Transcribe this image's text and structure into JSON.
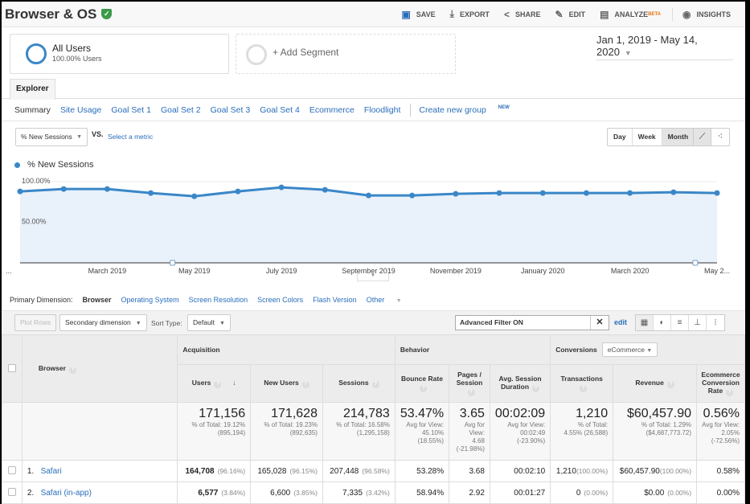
{
  "header": {
    "title": "Browser & OS",
    "actions": [
      {
        "label": "SAVE",
        "icon": "save-icon"
      },
      {
        "label": "EXPORT",
        "icon": "export-icon"
      },
      {
        "label": "SHARE",
        "icon": "share-icon"
      },
      {
        "label": "EDIT",
        "icon": "pencil-icon"
      },
      {
        "label": "ANALYZE",
        "icon": "analyze-icon",
        "badge": "BETA"
      },
      {
        "label": "INSIGHTS",
        "icon": "insights-icon"
      }
    ]
  },
  "segments": {
    "active": {
      "name": "All Users",
      "sub": "100.00% Users"
    },
    "add_label": "+ Add Segment"
  },
  "date_range": "Jan 1, 2019 - May 14, 2020",
  "tabs": {
    "explorer": "Explorer"
  },
  "subtabs": {
    "items": [
      "Summary",
      "Site Usage",
      "Goal Set 1",
      "Goal Set 2",
      "Goal Set 3",
      "Goal Set 4",
      "Ecommerce",
      "Floodlight"
    ],
    "create": "Create new group",
    "create_badge": "NEW"
  },
  "chart_controls": {
    "metric": "% New Sessions",
    "vs": "VS.",
    "select_metric": "Select a metric",
    "periods": [
      "Day",
      "Week",
      "Month"
    ],
    "active_period": "Month"
  },
  "chart_data": {
    "type": "area",
    "legend": "% New Sessions",
    "ylabels": [
      "100.00%",
      "50.00%"
    ],
    "ylim": [
      0,
      100
    ],
    "x": [
      "Jan 2019",
      "Feb 2019",
      "Mar 2019",
      "Apr 2019",
      "May 2019",
      "Jun 2019",
      "Jul 2019",
      "Aug 2019",
      "Sep 2019",
      "Oct 2019",
      "Nov 2019",
      "Dec 2019",
      "Jan 2020",
      "Feb 2020",
      "Mar 2020",
      "Apr 2020",
      "May 2020"
    ],
    "values": [
      88,
      91,
      91,
      86,
      82,
      88,
      93,
      90,
      83,
      83,
      85,
      86,
      86,
      86,
      86,
      87,
      86
    ],
    "xticks": [
      {
        "label": "...",
        "index": 0
      },
      {
        "label": "March 2019",
        "index": 2
      },
      {
        "label": "May 2019",
        "index": 4
      },
      {
        "label": "July 2019",
        "index": 6
      },
      {
        "label": "September 2019",
        "index": 8
      },
      {
        "label": "November 2019",
        "index": 10
      },
      {
        "label": "January 2020",
        "index": 12
      },
      {
        "label": "March 2020",
        "index": 14
      },
      {
        "label": "May 2...",
        "index": 16
      }
    ],
    "annotation_indices": [
      3,
      15
    ]
  },
  "dimensions": {
    "label": "Primary Dimension:",
    "active": "Browser",
    "others": [
      "Operating System",
      "Screen Resolution",
      "Screen Colors",
      "Flash Version"
    ],
    "other": "Other"
  },
  "toolbar": {
    "plot_rows": "Plot Rows",
    "secondary": "Secondary dimension",
    "sort_label": "Sort Type:",
    "sort_value": "Default",
    "filter_value": "Advanced Filter ON",
    "edit": "edit"
  },
  "table": {
    "dim_header": "Browser",
    "groups": {
      "acq": "Acquisition",
      "beh": "Behavior",
      "conv": "Conversions",
      "conv_select": "eCommerce"
    },
    "columns": [
      "Users",
      "New Users",
      "Sessions",
      "Bounce Rate",
      "Pages / Session",
      "Avg. Session Duration",
      "Transactions",
      "Revenue",
      "Ecommerce Conversion Rate"
    ],
    "totals": [
      {
        "value": "171,156",
        "sub1": "% of Total: 19.12%",
        "sub2": "(895,194)"
      },
      {
        "value": "171,628",
        "sub1": "% of Total: 19.23%",
        "sub2": "(892,635)"
      },
      {
        "value": "214,783",
        "sub1": "% of Total: 16.58%",
        "sub2": "(1,295,158)"
      },
      {
        "value": "53.47%",
        "sub1": "Avg for View:",
        "sub2": "45.10% (18.55%)"
      },
      {
        "value": "3.65",
        "sub1": "Avg for View:",
        "sub2": "4.68 (-21.98%)"
      },
      {
        "value": "00:02:09",
        "sub1": "Avg for View:",
        "sub2": "00:02:49 (-23.90%)"
      },
      {
        "value": "1,210",
        "sub1": "% of Total:",
        "sub2": "4.55% (26,588)"
      },
      {
        "value": "$60,457.90",
        "sub1": "% of Total: 1.29%",
        "sub2": "($4,687,773.72)"
      },
      {
        "value": "0.56%",
        "sub1": "Avg for View: 2.05%",
        "sub2": "(-72.56%)"
      }
    ],
    "rows": [
      {
        "num": "1.",
        "name": "Safari",
        "users": "164,708",
        "users_pct": "(96.16%)",
        "new_users": "165,028",
        "new_users_pct": "(96.15%)",
        "sessions": "207,448",
        "sessions_pct": "(96.58%)",
        "bounce": "53.28%",
        "pages": "3.68",
        "duration": "00:02:10",
        "trans": "1,210",
        "trans_pct": "(100.00%)",
        "revenue": "$60,457.90",
        "revenue_pct": "(100.00%)",
        "conv": "0.58%"
      },
      {
        "num": "2.",
        "name": "Safari (in-app)",
        "users": "6,577",
        "users_pct": "(3.84%)",
        "new_users": "6,600",
        "new_users_pct": "(3.85%)",
        "sessions": "7,335",
        "sessions_pct": "(3.42%)",
        "bounce": "58.94%",
        "pages": "2.92",
        "duration": "00:01:27",
        "trans": "0",
        "trans_pct": "(0.00%)",
        "revenue": "$0.00",
        "revenue_pct": "(0.00%)",
        "conv": "0.00%"
      }
    ]
  }
}
